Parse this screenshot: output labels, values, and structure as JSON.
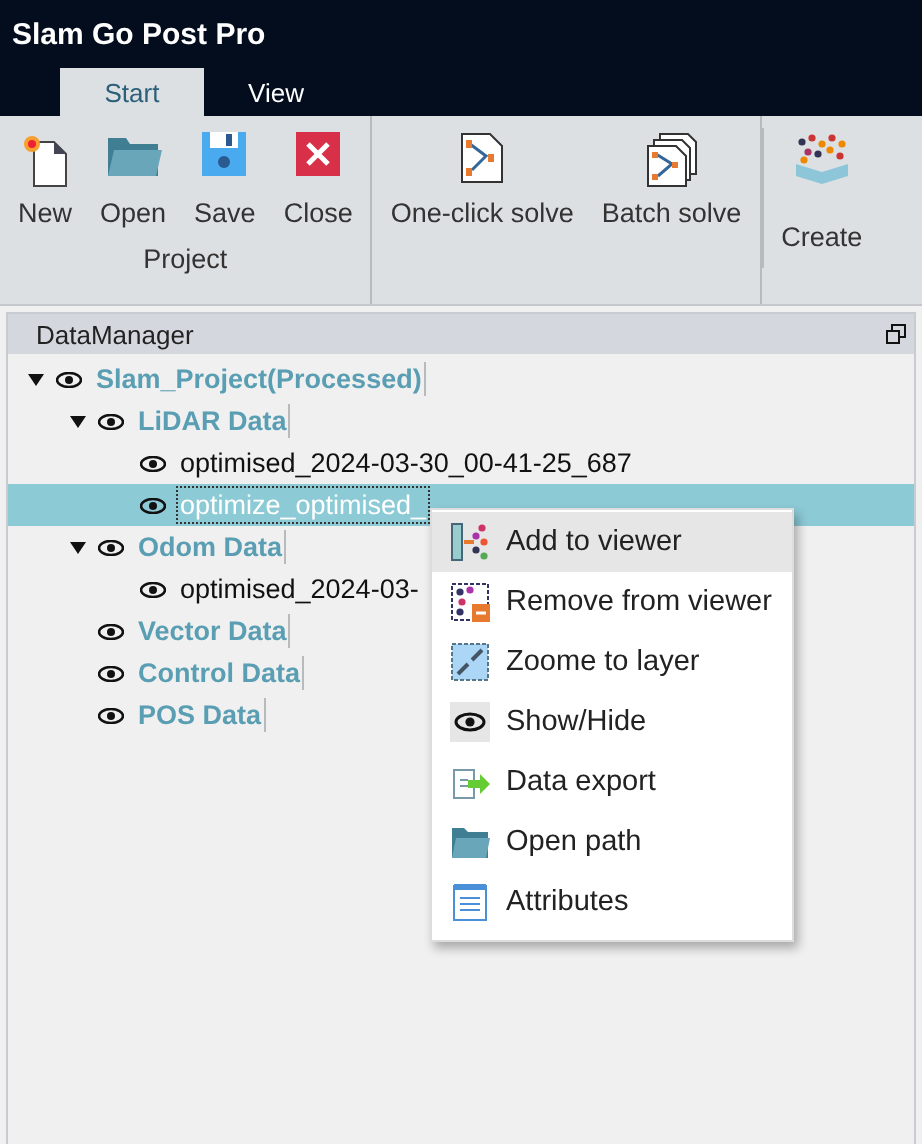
{
  "window": {
    "title": "Slam Go Post Pro"
  },
  "tabs": [
    {
      "label": "Start",
      "selected": true
    },
    {
      "label": "View",
      "selected": false
    }
  ],
  "ribbon": {
    "groups": [
      {
        "label": "Project",
        "buttons": [
          {
            "label": "New",
            "kind": "new"
          },
          {
            "label": "Open",
            "kind": "open"
          },
          {
            "label": "Save",
            "kind": "save"
          },
          {
            "label": "Close",
            "kind": "close"
          }
        ]
      },
      {
        "buttons": [
          {
            "label": "One-click solve",
            "kind": "solve"
          },
          {
            "label": "Batch solve",
            "kind": "batch"
          }
        ]
      },
      {
        "buttons": [
          {
            "label": "Create",
            "kind": "create"
          }
        ]
      }
    ]
  },
  "panel": {
    "title": "DataManager",
    "tree": [
      {
        "label": "Slam_Project(Processed)",
        "kind": "group",
        "expanded": true,
        "children": [
          {
            "label": "LiDAR Data",
            "kind": "group",
            "expanded": true,
            "children": [
              {
                "label": "optimised_2024-03-30_00-41-25_687",
                "kind": "file",
                "selected": false
              },
              {
                "label": "optimize_optimised_",
                "kind": "file",
                "selected": true
              }
            ]
          },
          {
            "label": "Odom Data",
            "kind": "group",
            "expanded": true,
            "children": [
              {
                "label": "optimised_2024-03-",
                "kind": "file",
                "selected": false
              }
            ]
          },
          {
            "label": "Vector Data",
            "kind": "group"
          },
          {
            "label": "Control Data",
            "kind": "group"
          },
          {
            "label": "POS Data",
            "kind": "group"
          }
        ]
      }
    ]
  },
  "context_menu": [
    {
      "label": "Add to viewer",
      "kind": "add",
      "selected": true
    },
    {
      "label": "Remove from viewer",
      "kind": "remove",
      "selected": false
    },
    {
      "label": "Zoome to layer",
      "kind": "zoom",
      "selected": false
    },
    {
      "label": "Show/Hide",
      "kind": "eye",
      "selected": false
    },
    {
      "label": "Data export",
      "kind": "export",
      "selected": false
    },
    {
      "label": "Open path",
      "kind": "folder",
      "selected": false
    },
    {
      "label": "Attributes",
      "kind": "attrs",
      "selected": false
    }
  ]
}
